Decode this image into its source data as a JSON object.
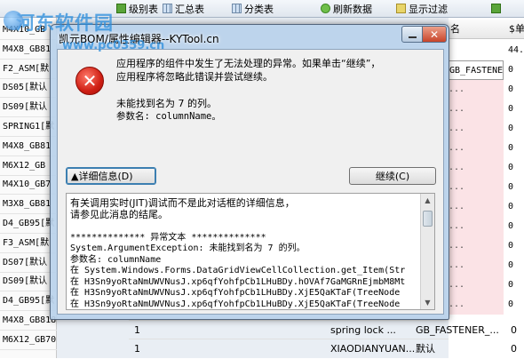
{
  "toolbar": {
    "items": [
      {
        "label": "级别表",
        "icon": "check-icon"
      },
      {
        "label": "汇总表",
        "icon": "grid-icon"
      },
      {
        "label": "分类表",
        "icon": "grid-icon"
      },
      {
        "label": "刷新数据",
        "icon": "refresh-icon"
      },
      {
        "label": "显示过滤",
        "icon": "filter-icon"
      },
      {
        "label": "",
        "icon": "check-icon"
      }
    ]
  },
  "watermark": {
    "name": "河东软件园",
    "url": "www.pc0359.cn"
  },
  "left_rows": [
    "M4X10_GB",
    "M4X8_GB81",
    "F2_ASM[默",
    "DS05[默认",
    "DS09[默认",
    "SPRING1[默",
    "M4X8_GB81",
    "M6X12_GB",
    "M4X10_GB7",
    "M3X8_GB81",
    "D4_GB95[默",
    "F3_ASM[默",
    "DS07[默认",
    "DS09[默认",
    "D4_GB95[默",
    "M4X8_GB818[默",
    "M6X12_GB70[默"
  ],
  "right_header": {
    "col1": "名",
    "col2": "$单"
  },
  "right_cells": [
    {
      "text": "",
      "col": 2,
      "value": "44."
    },
    {
      "text": "GB_FASTENER_...",
      "col": 1,
      "value": "0"
    },
    {
      "text": "...",
      "col": 1,
      "value": "0"
    },
    {
      "text": "...",
      "col": 1,
      "value": "0"
    },
    {
      "text": "...",
      "col": 1,
      "value": "0"
    },
    {
      "text": "...",
      "col": 1,
      "value": "0"
    },
    {
      "text": "...",
      "col": 1,
      "value": "0"
    },
    {
      "text": "...",
      "col": 1,
      "value": "0"
    },
    {
      "text": "...",
      "col": 1,
      "value": "0"
    },
    {
      "text": "...",
      "col": 1,
      "value": "0"
    },
    {
      "text": "...",
      "col": 1,
      "value": "0"
    },
    {
      "text": "...",
      "col": 1,
      "value": "0"
    },
    {
      "text": "...",
      "col": 1,
      "value": "0"
    },
    {
      "text": "...",
      "col": 1,
      "value": "0"
    }
  ],
  "bottom_rows": [
    {
      "num": "1",
      "name": "spring lock ...",
      "cat": "GB_FASTENER_...",
      "value": "0"
    },
    {
      "num": "1",
      "name": "XIAODIANYUAN...",
      "cat": "默认",
      "value": "0"
    }
  ],
  "dialog": {
    "title": "凯元BOM/属性编辑器--KYTool.cn",
    "icon": "error-icon",
    "icon_glyph": "✕",
    "message_line1": "应用程序的组件中发生了无法处理的异常。如果单击“继续”，",
    "message_line2": "应用程序将忽略此错误并尝试继续。",
    "message_line3": "未能找到名为 7 的列。",
    "message_line4": "参数名: columnName。",
    "details_button": "▲详细信息(D)",
    "continue_button": "继续(C)",
    "details_lines": [
      "有关调用实时(JIT)调试而不是此对话框的详细信息，",
      "请参见此消息的结尾。",
      "",
      "************** 异常文本 **************",
      "System.ArgumentException: 未能找到名为 7 的列。",
      "参数名: columnName",
      "   在 System.Windows.Forms.DataGridViewCellCollection.get_Item(Str",
      "   在 H3Sn9yoRtaNmUWVNusJ.xp6qfYohfpCb1LHuBDy.hOVAf7GaMGRnEjmbM8Mt",
      "   在 H3Sn9yoRtaNmUWVNusJ.xp6qfYohfpCb1LHuBDy.XjE5QaKTaF(TreeNode",
      "   在 H3Sn9yoRtaNmUWVNusJ.xp6qfYohfpCb1LHuBDy.XjE5QaKTaF(TreeNode"
    ]
  }
}
